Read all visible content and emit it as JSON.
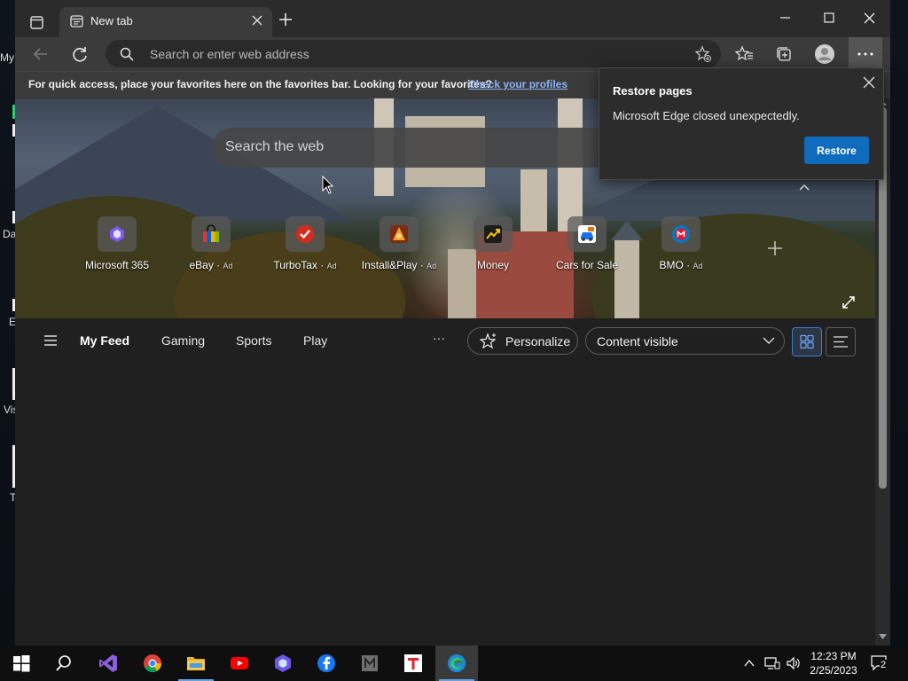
{
  "desktop": {
    "labels": [
      "My",
      "Da",
      "E",
      "Vis",
      "T"
    ]
  },
  "tab": {
    "title": "New tab"
  },
  "toolbar": {
    "address_placeholder": "Search or enter web address"
  },
  "favorites_bar": {
    "message": "For quick access, place your favorites here on the favorites bar. Looking for your favorites?",
    "link": "Check your profiles"
  },
  "hero": {
    "search_placeholder": "Search the web",
    "tiles": [
      {
        "label": "Microsoft 365",
        "ad": "",
        "color": "#7b5cf0",
        "icon": "m365-icon"
      },
      {
        "label": "eBay",
        "ad": "Ad",
        "color": "#e53238",
        "icon": "ebay-icon"
      },
      {
        "label": "TurboTax",
        "ad": "Ad",
        "color": "#d52b1e",
        "icon": "turbotax-icon"
      },
      {
        "label": "Install&Play",
        "ad": "Ad",
        "color": "#d9822b",
        "icon": "installplay-icon"
      },
      {
        "label": "Money",
        "ad": "",
        "color": "#2b2b2b",
        "icon": "money-icon"
      },
      {
        "label": "Cars for Sale",
        "ad": "",
        "color": "#1a73e8",
        "icon": "cars-icon"
      },
      {
        "label": "BMO",
        "ad": "Ad",
        "color": "#0079c1",
        "icon": "bmo-icon"
      }
    ]
  },
  "feed": {
    "tabs": [
      "My Feed",
      "Gaming",
      "Sports",
      "Play"
    ],
    "more": "···",
    "personalize": "Personalize",
    "content_select": "Content visible"
  },
  "popup": {
    "title": "Restore pages",
    "message": "Microsoft Edge closed unexpectedly.",
    "button": "Restore"
  },
  "taskbar": {
    "time": "12:23 PM",
    "date": "2/25/2023",
    "notifications": "2"
  }
}
